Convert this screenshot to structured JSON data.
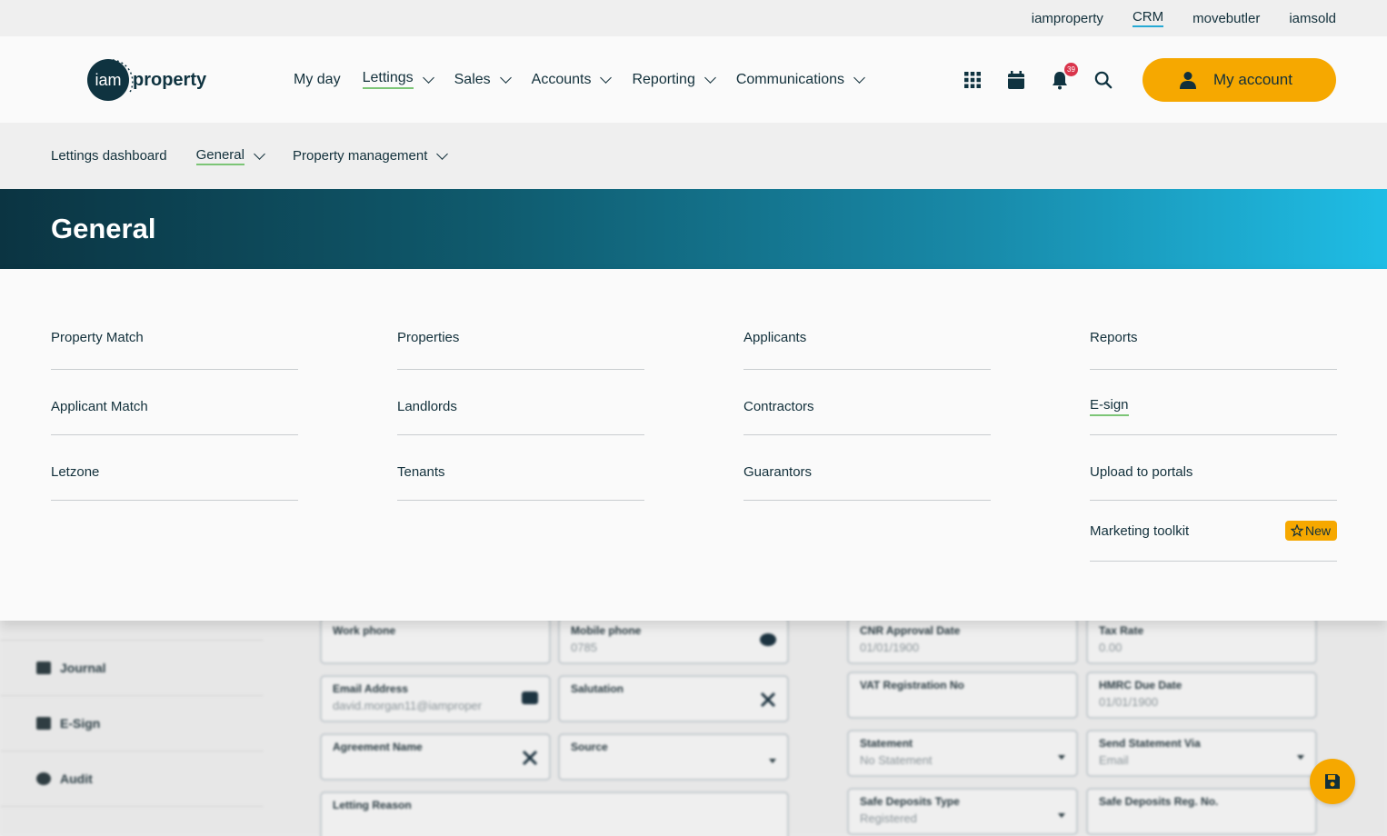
{
  "utility_links": [
    "iamproperty",
    "CRM",
    "movebutler",
    "iamsold"
  ],
  "logo": {
    "mark": "iam",
    "word": "property"
  },
  "main_nav": [
    {
      "label": "My day",
      "dropdown": false
    },
    {
      "label": "Lettings",
      "dropdown": true,
      "active": true
    },
    {
      "label": "Sales",
      "dropdown": true
    },
    {
      "label": "Accounts",
      "dropdown": true
    },
    {
      "label": "Reporting",
      "dropdown": true
    },
    {
      "label": "Communications",
      "dropdown": true
    }
  ],
  "header_icons": [
    "apps-grid-icon",
    "calendar-icon",
    "bell-icon",
    "search-icon"
  ],
  "notifications_count": "39",
  "account_button": {
    "label": "My account",
    "icon": "user-icon"
  },
  "sub_nav": [
    {
      "label": "Lettings dashboard",
      "dropdown": false
    },
    {
      "label": "General",
      "dropdown": true,
      "active": true
    },
    {
      "label": "Property management",
      "dropdown": true
    }
  ],
  "hero_title": "General",
  "menu_columns": [
    [
      "Property Match",
      "Applicant Match",
      "Letzone"
    ],
    [
      "Properties",
      "Landlords",
      "Tenants"
    ],
    [
      "Applicants",
      "Contractors",
      "Guarantors"
    ],
    [
      "Reports",
      "E-sign",
      "Upload to portals",
      "Marketing toolkit"
    ]
  ],
  "new_badge": "New",
  "background": {
    "sidebar": [
      "Journal",
      "E-Sign",
      "Audit"
    ],
    "fields": {
      "work_phone": {
        "label": "Work phone",
        "value": ""
      },
      "mobile_phone": {
        "label": "Mobile phone",
        "value": "0785"
      },
      "email": {
        "label": "Email Address",
        "value": "david.morgan11@iamproper"
      },
      "salutation": {
        "label": "Salutation",
        "value": ""
      },
      "agreement_name": {
        "label": "Agreement Name",
        "value": ""
      },
      "source": {
        "label": "Source",
        "value": ""
      },
      "letting_reason": {
        "label": "Letting Reason",
        "value": ""
      },
      "cnr_date": {
        "label": "CNR Approval Date",
        "value": "01/01/1900"
      },
      "tax_rate": {
        "label": "Tax Rate",
        "value": "0.00"
      },
      "vat_no": {
        "label": "VAT Registration No",
        "value": ""
      },
      "hmrc_date": {
        "label": "HMRC Due Date",
        "value": "01/01/1900"
      },
      "statement": {
        "label": "Statement",
        "value": "No Statement"
      },
      "send_statement": {
        "label": "Send Statement Via",
        "value": "Email"
      },
      "deposit_type": {
        "label": "Safe Deposits Type",
        "value": "Registered"
      },
      "deposit_reg": {
        "label": "Safe Deposits Reg. No.",
        "value": ""
      }
    }
  },
  "colors": {
    "accent": "#f6a800",
    "dark": "#0f3340",
    "underline": "#7cc576"
  }
}
